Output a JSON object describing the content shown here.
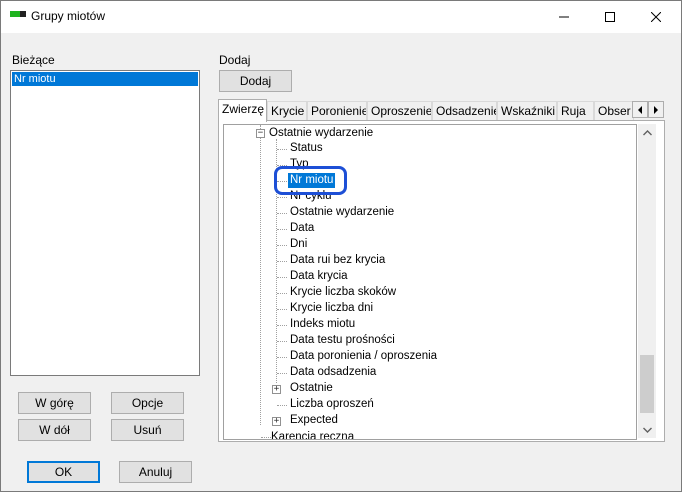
{
  "window": {
    "title": "Grupy miotów",
    "icons": {
      "app": "app-logo-icon",
      "minimize": "minimize-icon",
      "maximize": "maximize-icon",
      "close": "close-icon"
    },
    "colors": {
      "selection": "#0078d7",
      "annotation_ring": "#1d4fd6"
    }
  },
  "left_panel": {
    "label": "Bieżące",
    "items": [
      "Nr miotu"
    ],
    "buttons": {
      "up": "W górę",
      "options": "Opcje",
      "down": "W dół",
      "remove": "Usuń"
    }
  },
  "right_panel": {
    "label": "Dodaj",
    "add_button": "Dodaj",
    "tabs": [
      "Zwierzę",
      "Krycie",
      "Poronienie",
      "Oproszenie",
      "Odsadzenie",
      "Wskaźniki",
      "Ruja",
      "Obser"
    ],
    "active_tab": "Zwierzę"
  },
  "tree": {
    "top_partial": "Ostatnie wydarzenie",
    "selected": "Nr miotu",
    "items": [
      "Status",
      "Typ",
      "Nr miotu",
      "Nr cyklu",
      "Ostatnie wydarzenie",
      "Data",
      "Dni",
      "Data rui bez krycia",
      "Data krycia",
      "Krycie liczba skoków",
      "Krycie liczba dni",
      "Indeks miotu",
      "Data testu prośności",
      "Data poronienia / oproszenia",
      "Data odsadzenia"
    ],
    "collapsed_items": [
      "Ostatnie",
      "Liczba oproszeń",
      "Expected"
    ],
    "bottom_partial": "Karencja reczna"
  },
  "footer": {
    "ok": "OK",
    "cancel": "Anuluj"
  }
}
